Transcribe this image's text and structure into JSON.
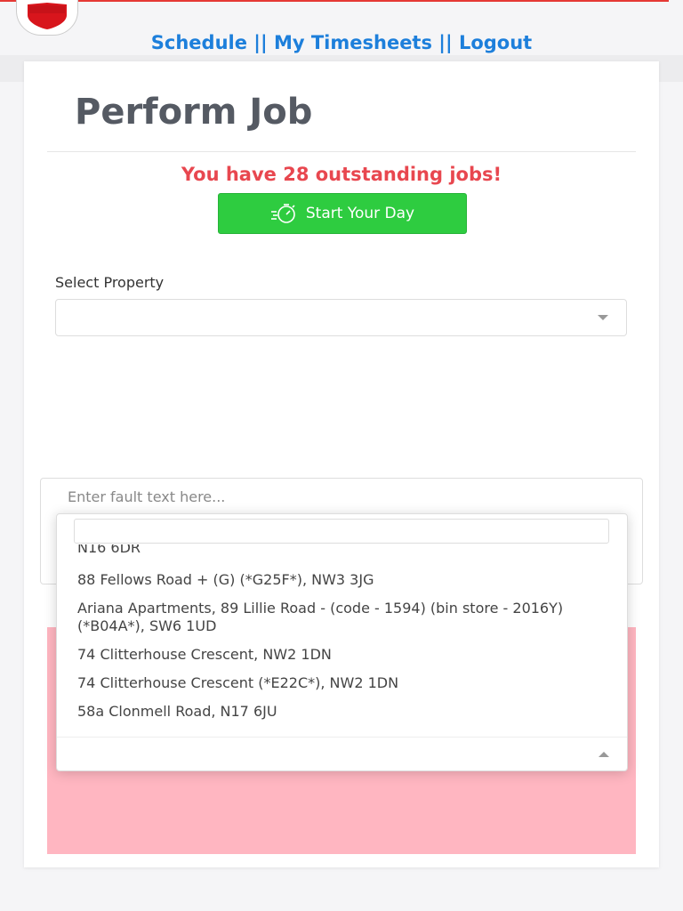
{
  "nav": {
    "links": [
      "Schedule",
      "My Timesheets",
      "Logout"
    ],
    "separator": "||"
  },
  "page": {
    "title": "Perform Job",
    "outstanding_message": "You have 28 outstanding jobs!",
    "start_button_label": "Start Your Day"
  },
  "property_select": {
    "label": "Select Property",
    "value": ""
  },
  "fault": {
    "placeholder": "Enter fault text here..."
  },
  "dropdown": {
    "search_value": "",
    "partial_item": "N16 6DR",
    "options": [
      "88 Fellows Road + (G) (*G25F*), NW3 3JG",
      "Ariana Apartments, 89 Lillie Road - (code - 1594) (bin store - 2016Y) (*B04A*), SW6 1UD",
      "74 Clitterhouse Crescent, NW2 1DN",
      "74 Clitterhouse Crescent (*E22C*), NW2 1DN",
      "58a Clonmell Road, N17 6JU"
    ]
  },
  "colors": {
    "accent_red": "#e53935",
    "link_blue": "#1d7fdb",
    "start_green": "#2ecc40",
    "warning_red": "#e8474f",
    "pink_area": "#ffb6c1"
  },
  "icons": {
    "logo": "shield-logo-icon",
    "start_button": "stopwatch-icon",
    "select_caret": "caret-down-icon",
    "dropdown_caret": "caret-up-icon"
  }
}
